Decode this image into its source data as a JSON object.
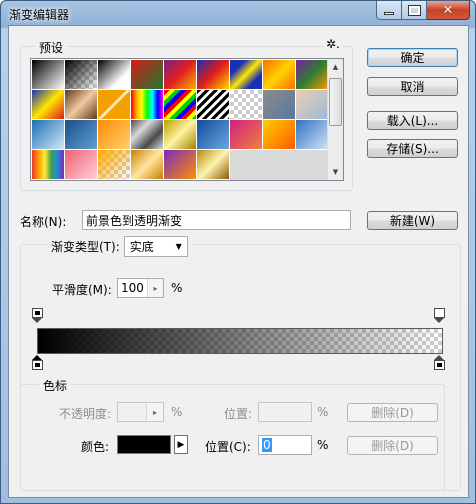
{
  "window": {
    "title": "渐变编辑器",
    "close_glyph": "✕"
  },
  "presets": {
    "label": "预设",
    "gear_glyph": "✲.",
    "scroll_up": "▲",
    "scroll_down": "▼"
  },
  "buttons": {
    "ok": "确定",
    "cancel": "取消",
    "load": "载入(L)...",
    "save": "存储(S)...",
    "new": "新建(W)",
    "delete_opacity": "删除(D)",
    "delete_color": "删除(D)"
  },
  "name": {
    "label": "名称(N):",
    "value": "前景色到透明渐变"
  },
  "gradient_type": {
    "label": "渐变类型(T):",
    "value": "实底",
    "arrow": "▼"
  },
  "smoothness": {
    "label": "平滑度(M):",
    "value": "100",
    "unit": "%",
    "arrow": "▸"
  },
  "color_stops": {
    "label": "色标",
    "opacity_label": "不透明度:",
    "opacity_unit": "%",
    "opacity_arrow": "▸",
    "location_label_disabled": "位置:",
    "location_unit_disabled": "%",
    "color_label": "颜色:",
    "color_arrow": "▶",
    "location_label": "位置(C):",
    "location_value": "0",
    "location_unit": "%"
  },
  "colors": {
    "title_bg": "#a9c5e2",
    "dialog_bg": "#f0f0f0",
    "default_border": "#3c7fb1",
    "close_red": "#c7422a",
    "selected_color": "#000000"
  }
}
